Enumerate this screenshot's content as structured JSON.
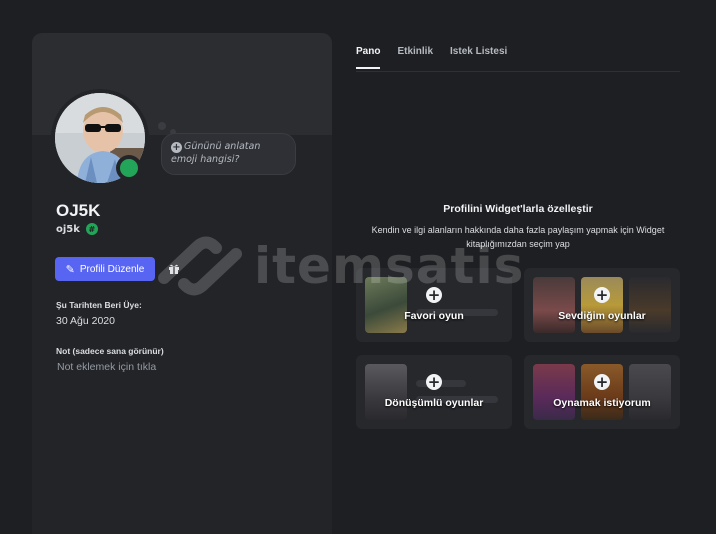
{
  "profile": {
    "emoji_prompt": "Gününü anlatan emoji hangisi?",
    "display_name": "OJ5K",
    "username": "oj5k",
    "badge_icon": "hash-badge-icon",
    "status_color": "#23a559",
    "edit_button_label": "Profili Düzenle",
    "member_since_label": "Şu Tarihten Beri Üye:",
    "member_since_value": "30 Ağu 2020",
    "note_label": "Not (sadece sana görünür)",
    "note_placeholder": "Not eklemek için tıkla"
  },
  "tabs": [
    {
      "label": "Pano",
      "active": true
    },
    {
      "label": "Etkinlik",
      "active": false
    },
    {
      "label": "Istek Listesi",
      "active": false
    }
  ],
  "widgets": {
    "title": "Profilini Widget'larla özelleştir",
    "description": "Kendin ve ilgi alanların hakkında daha fazla paylaşım yapmak için Widget kitaplığımızdan seçim yap",
    "cards": [
      {
        "label": "Favori oyun"
      },
      {
        "label": "Sevdiğim oyunlar"
      },
      {
        "label": "Dönüşümlü oyunlar"
      },
      {
        "label": "Oynamak istiyorum"
      }
    ]
  },
  "watermark": {
    "text": "itemsatis"
  },
  "colors": {
    "accent": "#5865f2",
    "online": "#23a559",
    "background": "#1e1f22",
    "card": "#232428"
  }
}
